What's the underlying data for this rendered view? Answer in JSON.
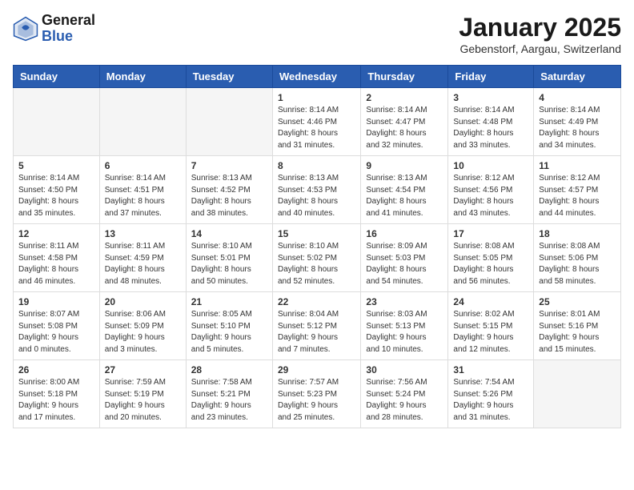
{
  "header": {
    "logo_general": "General",
    "logo_blue": "Blue",
    "title": "January 2025",
    "location": "Gebenstorf, Aargau, Switzerland"
  },
  "days_of_week": [
    "Sunday",
    "Monday",
    "Tuesday",
    "Wednesday",
    "Thursday",
    "Friday",
    "Saturday"
  ],
  "weeks": [
    [
      {
        "day": "",
        "info": ""
      },
      {
        "day": "",
        "info": ""
      },
      {
        "day": "",
        "info": ""
      },
      {
        "day": "1",
        "info": "Sunrise: 8:14 AM\nSunset: 4:46 PM\nDaylight: 8 hours\nand 31 minutes."
      },
      {
        "day": "2",
        "info": "Sunrise: 8:14 AM\nSunset: 4:47 PM\nDaylight: 8 hours\nand 32 minutes."
      },
      {
        "day": "3",
        "info": "Sunrise: 8:14 AM\nSunset: 4:48 PM\nDaylight: 8 hours\nand 33 minutes."
      },
      {
        "day": "4",
        "info": "Sunrise: 8:14 AM\nSunset: 4:49 PM\nDaylight: 8 hours\nand 34 minutes."
      }
    ],
    [
      {
        "day": "5",
        "info": "Sunrise: 8:14 AM\nSunset: 4:50 PM\nDaylight: 8 hours\nand 35 minutes."
      },
      {
        "day": "6",
        "info": "Sunrise: 8:14 AM\nSunset: 4:51 PM\nDaylight: 8 hours\nand 37 minutes."
      },
      {
        "day": "7",
        "info": "Sunrise: 8:13 AM\nSunset: 4:52 PM\nDaylight: 8 hours\nand 38 minutes."
      },
      {
        "day": "8",
        "info": "Sunrise: 8:13 AM\nSunset: 4:53 PM\nDaylight: 8 hours\nand 40 minutes."
      },
      {
        "day": "9",
        "info": "Sunrise: 8:13 AM\nSunset: 4:54 PM\nDaylight: 8 hours\nand 41 minutes."
      },
      {
        "day": "10",
        "info": "Sunrise: 8:12 AM\nSunset: 4:56 PM\nDaylight: 8 hours\nand 43 minutes."
      },
      {
        "day": "11",
        "info": "Sunrise: 8:12 AM\nSunset: 4:57 PM\nDaylight: 8 hours\nand 44 minutes."
      }
    ],
    [
      {
        "day": "12",
        "info": "Sunrise: 8:11 AM\nSunset: 4:58 PM\nDaylight: 8 hours\nand 46 minutes."
      },
      {
        "day": "13",
        "info": "Sunrise: 8:11 AM\nSunset: 4:59 PM\nDaylight: 8 hours\nand 48 minutes."
      },
      {
        "day": "14",
        "info": "Sunrise: 8:10 AM\nSunset: 5:01 PM\nDaylight: 8 hours\nand 50 minutes."
      },
      {
        "day": "15",
        "info": "Sunrise: 8:10 AM\nSunset: 5:02 PM\nDaylight: 8 hours\nand 52 minutes."
      },
      {
        "day": "16",
        "info": "Sunrise: 8:09 AM\nSunset: 5:03 PM\nDaylight: 8 hours\nand 54 minutes."
      },
      {
        "day": "17",
        "info": "Sunrise: 8:08 AM\nSunset: 5:05 PM\nDaylight: 8 hours\nand 56 minutes."
      },
      {
        "day": "18",
        "info": "Sunrise: 8:08 AM\nSunset: 5:06 PM\nDaylight: 8 hours\nand 58 minutes."
      }
    ],
    [
      {
        "day": "19",
        "info": "Sunrise: 8:07 AM\nSunset: 5:08 PM\nDaylight: 9 hours\nand 0 minutes."
      },
      {
        "day": "20",
        "info": "Sunrise: 8:06 AM\nSunset: 5:09 PM\nDaylight: 9 hours\nand 3 minutes."
      },
      {
        "day": "21",
        "info": "Sunrise: 8:05 AM\nSunset: 5:10 PM\nDaylight: 9 hours\nand 5 minutes."
      },
      {
        "day": "22",
        "info": "Sunrise: 8:04 AM\nSunset: 5:12 PM\nDaylight: 9 hours\nand 7 minutes."
      },
      {
        "day": "23",
        "info": "Sunrise: 8:03 AM\nSunset: 5:13 PM\nDaylight: 9 hours\nand 10 minutes."
      },
      {
        "day": "24",
        "info": "Sunrise: 8:02 AM\nSunset: 5:15 PM\nDaylight: 9 hours\nand 12 minutes."
      },
      {
        "day": "25",
        "info": "Sunrise: 8:01 AM\nSunset: 5:16 PM\nDaylight: 9 hours\nand 15 minutes."
      }
    ],
    [
      {
        "day": "26",
        "info": "Sunrise: 8:00 AM\nSunset: 5:18 PM\nDaylight: 9 hours\nand 17 minutes."
      },
      {
        "day": "27",
        "info": "Sunrise: 7:59 AM\nSunset: 5:19 PM\nDaylight: 9 hours\nand 20 minutes."
      },
      {
        "day": "28",
        "info": "Sunrise: 7:58 AM\nSunset: 5:21 PM\nDaylight: 9 hours\nand 23 minutes."
      },
      {
        "day": "29",
        "info": "Sunrise: 7:57 AM\nSunset: 5:23 PM\nDaylight: 9 hours\nand 25 minutes."
      },
      {
        "day": "30",
        "info": "Sunrise: 7:56 AM\nSunset: 5:24 PM\nDaylight: 9 hours\nand 28 minutes."
      },
      {
        "day": "31",
        "info": "Sunrise: 7:54 AM\nSunset: 5:26 PM\nDaylight: 9 hours\nand 31 minutes."
      },
      {
        "day": "",
        "info": ""
      }
    ]
  ]
}
